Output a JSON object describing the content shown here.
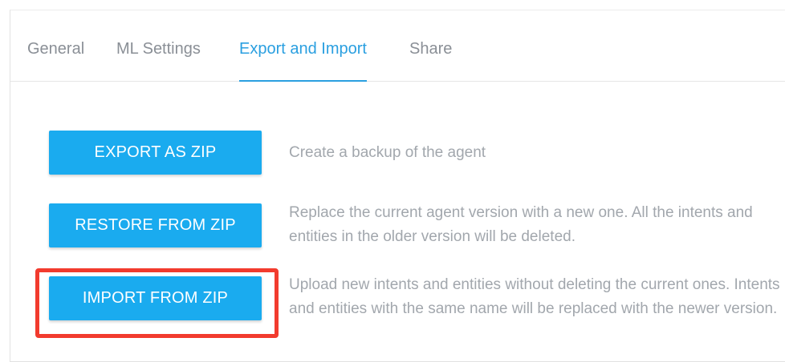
{
  "tabs": [
    {
      "label": "General",
      "active": false
    },
    {
      "label": "ML Settings",
      "active": false
    },
    {
      "label": "Export and Import",
      "active": true
    },
    {
      "label": "Share",
      "active": false
    }
  ],
  "actions": [
    {
      "button_label": "EXPORT AS ZIP",
      "description": "Create a backup of the agent"
    },
    {
      "button_label": "RESTORE FROM ZIP",
      "description": "Replace the current agent version with a new one. All the intents and entities in the older version will be deleted."
    },
    {
      "button_label": "IMPORT FROM ZIP",
      "description": "Upload new intents and entities without deleting the current ones. Intents and entities with the same name will be replaced with the newer version.",
      "highlighted": true
    }
  ],
  "colors": {
    "accent": "#2a9fe0",
    "button": "#1aabef",
    "highlight": "#f23b2e",
    "inactive_tab": "#8a8f96",
    "description_text": "#a2a7ad"
  }
}
